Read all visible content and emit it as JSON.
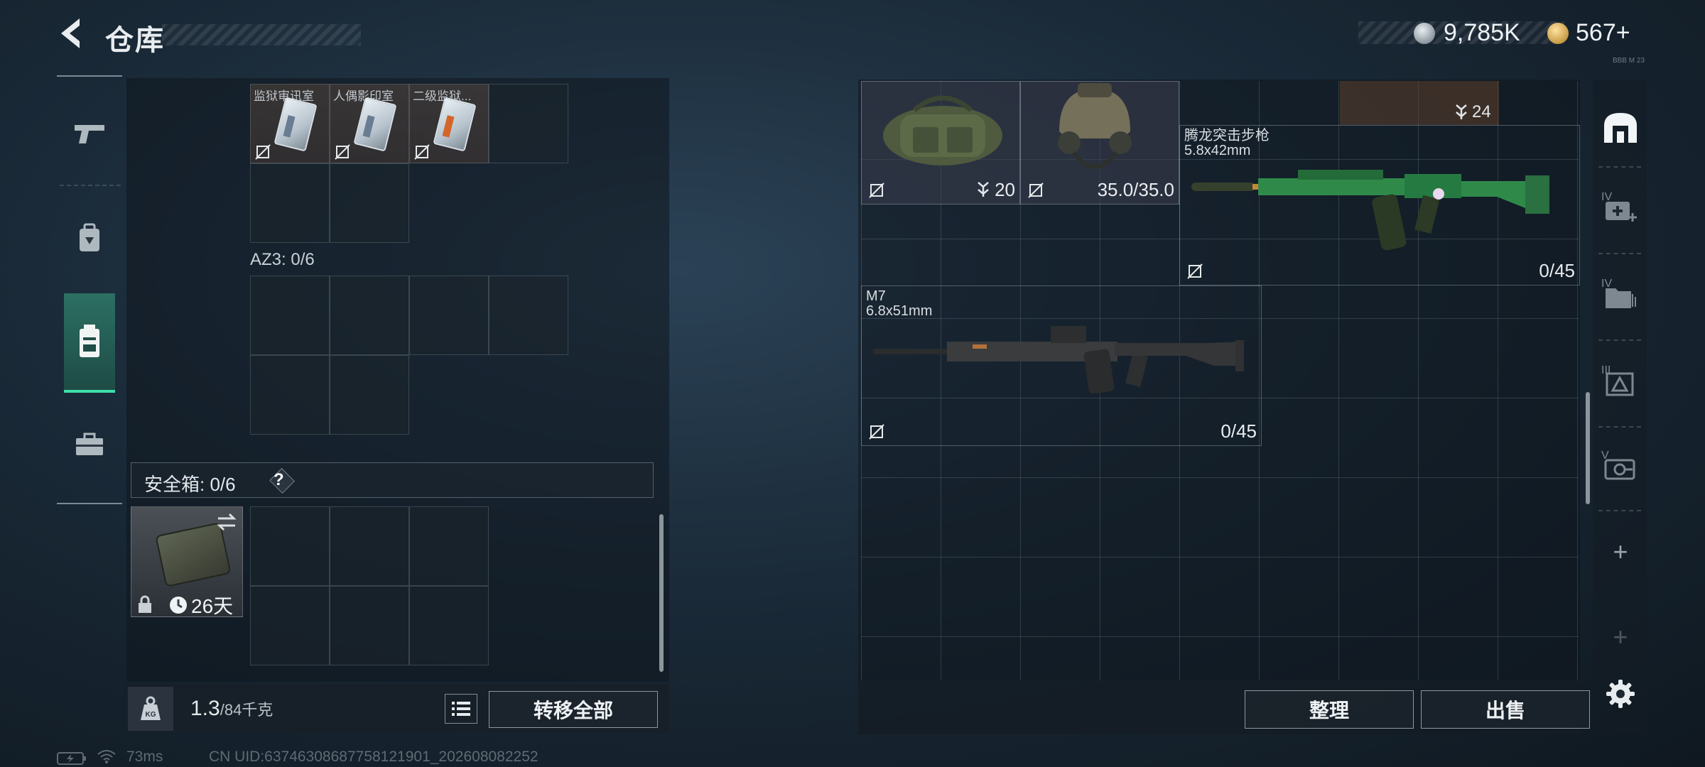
{
  "header": {
    "title": "仓库",
    "currency_1": "9,785K",
    "currency_2": "567+",
    "version_tiny": "BBB M 23"
  },
  "left_sidebar": {
    "items": [
      {
        "icon": "pistol-icon"
      },
      {
        "icon": "backpack-icon"
      },
      {
        "icon": "rig-icon",
        "active": true
      },
      {
        "icon": "toolbox-icon"
      }
    ]
  },
  "left_panel": {
    "keycards": [
      {
        "name": "监狱审讯室",
        "variant": "blue"
      },
      {
        "name": "人偶影印室",
        "variant": "blue"
      },
      {
        "name": "二级监狱...",
        "variant": "orange"
      }
    ],
    "az3_label": "AZ3: 0/6",
    "safebox_label": "安全箱: 0/6",
    "safebox_help": "?",
    "safebox_days": "26天",
    "weight_value": "1.3",
    "weight_max": "/84千克",
    "kg_label": "KG",
    "transfer_all": "转移全部"
  },
  "right_panel": {
    "bag_count": "20",
    "helmet_durability": "35.0/35.0",
    "top_right_count": "24",
    "rifle_1": {
      "name": "腾龙突击步枪",
      "caliber": "5.8x42mm",
      "ammo": "0/45"
    },
    "rifle_2": {
      "name": "M7",
      "caliber": "6.8x51mm",
      "ammo": "0/45"
    },
    "sort_button": "整理",
    "sell_button": "出售"
  },
  "right_sidebar": {
    "levels": [
      "IV",
      "IV",
      "III",
      "V"
    ],
    "add": "+"
  },
  "status_bar": {
    "ping": "73ms",
    "uid": "CN UID:6374630868775812190​1_202608082252"
  },
  "colors": {
    "accent_green": "#3ee0a8",
    "rifle_green": "#2f8a4a"
  }
}
